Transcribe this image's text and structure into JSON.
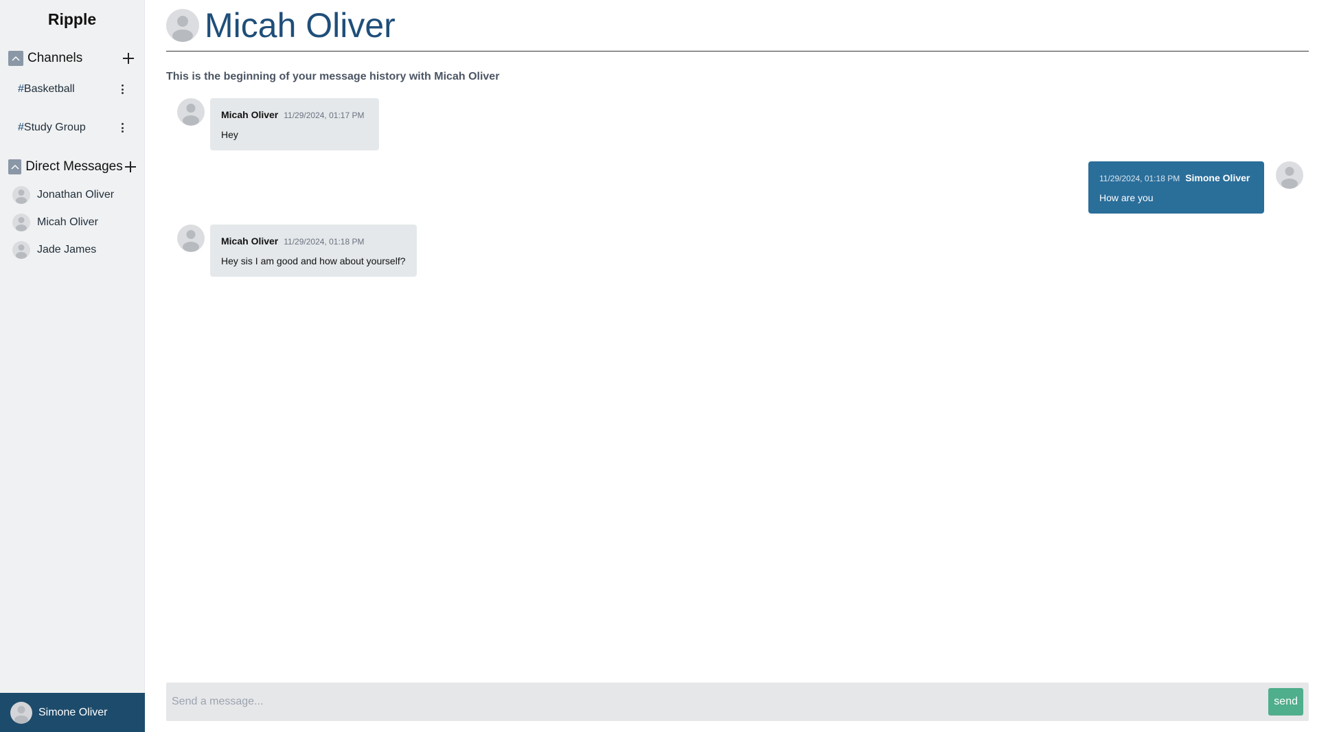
{
  "app": {
    "brand": "Ripple"
  },
  "sidebar": {
    "channels_title": "Channels",
    "channels": [
      {
        "hash": "#",
        "name": "Basketball"
      },
      {
        "hash": "#",
        "name": "Study Group"
      }
    ],
    "dms_title": "Direct Messages",
    "dms": [
      {
        "name": "Jonathan Oliver"
      },
      {
        "name": "Micah Oliver"
      },
      {
        "name": "Jade James"
      }
    ],
    "current_user": "Simone Oliver"
  },
  "chat": {
    "title": "Micah Oliver",
    "history_note": "This is the beginning of your message history with Micah Oliver",
    "messages": [
      {
        "sender": "Micah Oliver",
        "timestamp": "11/29/2024, 01:17 PM",
        "text": "Hey",
        "direction": "incoming"
      },
      {
        "sender": "Simone Oliver",
        "timestamp": "11/29/2024, 01:18 PM",
        "text": "How are you",
        "direction": "outgoing"
      },
      {
        "sender": "Micah Oliver",
        "timestamp": "11/29/2024, 01:18 PM",
        "text": "Hey sis I am good and how about yourself?",
        "direction": "incoming"
      }
    ]
  },
  "composer": {
    "placeholder": "Send a message...",
    "send_label": "send"
  },
  "colors": {
    "user_bar": "#1d4b6b",
    "outgoing_bubble": "#2a6e9a",
    "send_button": "#4fae8c",
    "title": "#1f4e79"
  }
}
